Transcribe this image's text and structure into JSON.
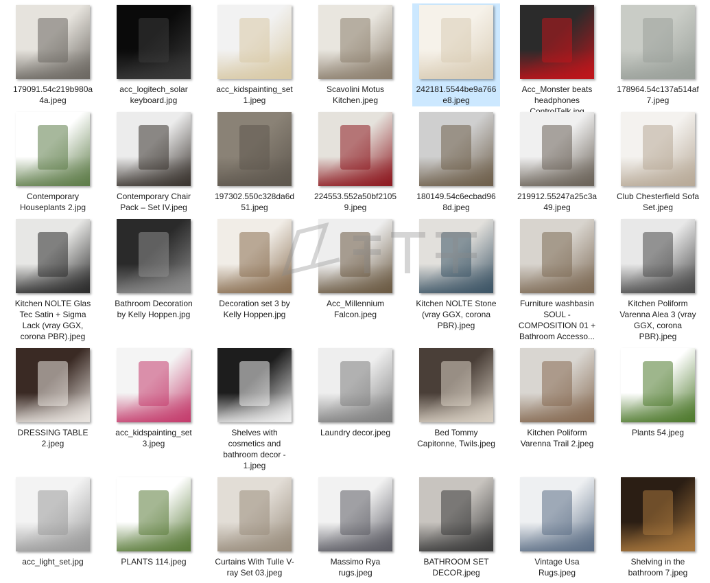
{
  "files": [
    {
      "name": "179091.54c219b980a4a.jpeg",
      "colors": [
        "#e6e3dd",
        "#6c6862"
      ]
    },
    {
      "name": "acc_logitech_solar keyboard.jpg",
      "colors": [
        "#0a0a0a",
        "#3a3a3a"
      ]
    },
    {
      "name": "acc_kidspainting_set 1.jpeg",
      "colors": [
        "#f2f2f2",
        "#d8c9a6"
      ]
    },
    {
      "name": "Scavolini Motus Kitchen.jpeg",
      "colors": [
        "#e9e6df",
        "#8c7f6e"
      ]
    },
    {
      "name": "242181.5544be9a766e8.jpeg",
      "colors": [
        "#f6f2ea",
        "#d9ccb5"
      ]
    },
    {
      "name": "Acc_Monster beats headphones ControlTalk.jpg",
      "colors": [
        "#2b2b2b",
        "#c0151b"
      ]
    },
    {
      "name": "178964.54c137a514af7.jpeg",
      "colors": [
        "#c9ccc6",
        "#9aa09a"
      ]
    },
    {
      "name": "Contemporary Houseplants 2.jpg",
      "colors": [
        "#ffffff",
        "#5f7d4a"
      ]
    },
    {
      "name": "Contemporary Chair Pack – Set IV.jpeg",
      "colors": [
        "#ececec",
        "#3b3530"
      ]
    },
    {
      "name": "197302.550c328da6d51.jpeg",
      "colors": [
        "#8a8276",
        "#5e574e"
      ]
    },
    {
      "name": "224553.552a50bf21059.jpeg",
      "colors": [
        "#e5e2dc",
        "#8e1b22"
      ]
    },
    {
      "name": "180149.54c6ecbad968d.jpeg",
      "colors": [
        "#cfcfcf",
        "#6f604c"
      ]
    },
    {
      "name": "219912.55247a25c3a49.jpeg",
      "colors": [
        "#f0f0f0",
        "#6b6359"
      ]
    },
    {
      "name": "Club Chesterfield Sofa Set.jpeg",
      "colors": [
        "#f4f2ef",
        "#b8aa98"
      ]
    },
    {
      "name": "Kitchen NOLTE Glas Tec Satin + Sigma Lack (vray GGX, corona PBR).jpeg",
      "colors": [
        "#e7e7e5",
        "#2c2c2c"
      ]
    },
    {
      "name": "Bathroom Decoration by Kelly Hoppen.jpg",
      "colors": [
        "#2a2a2a",
        "#8d8d8d"
      ]
    },
    {
      "name": "Decoration set 3 by Kelly Hoppen.jpg",
      "colors": [
        "#f1ede7",
        "#8a6f52"
      ]
    },
    {
      "name": "Acc_Millennium Falcon.jpeg",
      "colors": [
        "#eeeeee",
        "#6b5a43"
      ]
    },
    {
      "name": "Kitchen NOLTE Stone (vray GGX, corona PBR).jpeg",
      "colors": [
        "#e2e0dc",
        "#3d5566"
      ]
    },
    {
      "name": "Furniture washbasin SOUL - COMPOSITION 01 + Bathroom Accesso...",
      "colors": [
        "#d8d4ce",
        "#7e6b56"
      ]
    },
    {
      "name": "Kitchen Poliform Varenna Alea 3 (vray GGX, corona PBR).jpeg",
      "colors": [
        "#e8e8e8",
        "#4a4a4a"
      ]
    },
    {
      "name": "DRESSING TABLE 2.jpeg",
      "colors": [
        "#3a2a24",
        "#e9e4df"
      ]
    },
    {
      "name": "acc_kidspainting_set 3.jpeg",
      "colors": [
        "#f4f4f4",
        "#c43d6d"
      ]
    },
    {
      "name": "Shelves with cosmetics and bathroom decor - 1.jpeg",
      "colors": [
        "#1d1d1d",
        "#efefef"
      ]
    },
    {
      "name": "Laundry decor.jpeg",
      "colors": [
        "#eeeeee",
        "#7f7f7f"
      ]
    },
    {
      "name": "Bed Tommy Capitonne, Twils.jpeg",
      "colors": [
        "#4a3f38",
        "#d8cfc2"
      ]
    },
    {
      "name": "Kitchen Poliform Varenna Trail 2.jpeg",
      "colors": [
        "#d9d6d1",
        "#866a52"
      ]
    },
    {
      "name": "Plants 54.jpeg",
      "colors": [
        "#ffffff",
        "#4f7a2e"
      ]
    },
    {
      "name": "acc_light_set.jpg",
      "colors": [
        "#f3f3f3",
        "#9a9a9a"
      ]
    },
    {
      "name": "PLANTS 114.jpeg",
      "colors": [
        "#ffffff",
        "#5b7c3b"
      ]
    },
    {
      "name": "Curtains With Tulle V-ray Set 03.jpeg",
      "colors": [
        "#e2ddd6",
        "#9a8e7e"
      ]
    },
    {
      "name": "Massimo Rya rugs.jpeg",
      "colors": [
        "#f2f2f2",
        "#5c5c64"
      ]
    },
    {
      "name": "BATHROOM SET DECOR.jpeg",
      "colors": [
        "#c8c4bf",
        "#3b3b3b"
      ]
    },
    {
      "name": "Vintage Usa Rugs.jpeg",
      "colors": [
        "#eef0f2",
        "#5d6f86"
      ]
    },
    {
      "name": "Shelving in the bathroom 7.jpeg",
      "colors": [
        "#2b1e14",
        "#a8773d"
      ]
    }
  ],
  "selected_index": 4,
  "accent": "#cce8ff"
}
